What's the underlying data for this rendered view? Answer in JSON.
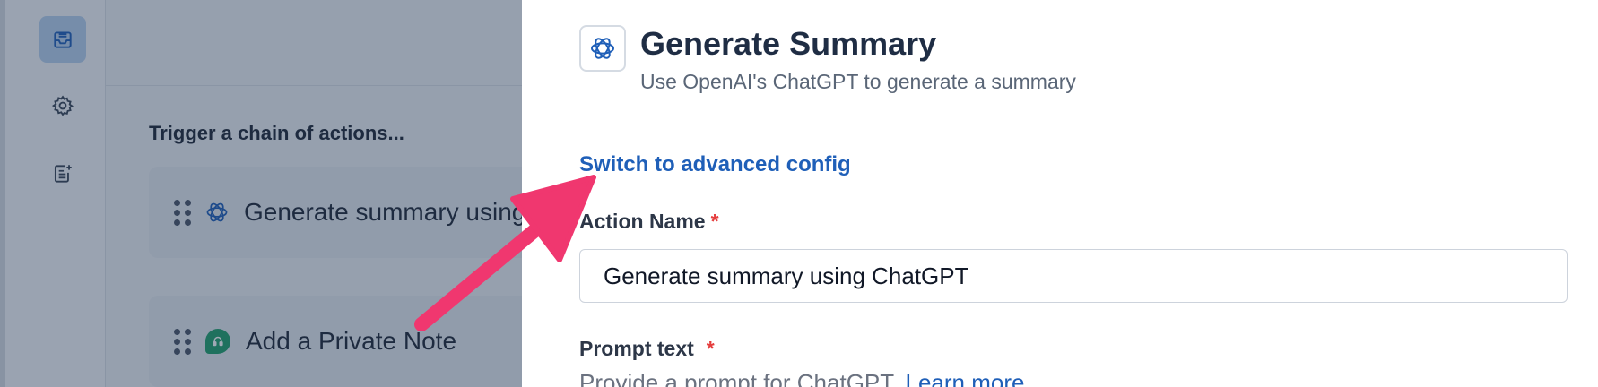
{
  "sidebar": {
    "items": [
      {
        "icon": "inbox-icon",
        "active": true
      },
      {
        "icon": "gear-icon",
        "active": false
      },
      {
        "icon": "notes-icon",
        "active": false
      }
    ]
  },
  "chain": {
    "title": "Trigger a chain of actions...",
    "actions": [
      {
        "label": "Generate summary using ChatGPT",
        "icon": "openai-icon"
      },
      {
        "label": "Add a Private Note",
        "icon": "private-note-icon"
      }
    ]
  },
  "panel": {
    "icon": "openai-icon",
    "title": "Generate Summary",
    "subtitle": "Use OpenAI's ChatGPT to generate a summary",
    "advanced_link": "Switch to advanced config",
    "action_name": {
      "label": "Action Name",
      "required_marker": "*",
      "value": "Generate summary using ChatGPT"
    },
    "prompt_text": {
      "label": "Prompt text",
      "required_marker": "*",
      "helper": "Provide a prompt for ChatGPT.",
      "learn_more": "Learn more"
    }
  },
  "annotation": {
    "type": "arrow",
    "color": "#f0376f"
  },
  "colors": {
    "accent": "#1f5fb8",
    "required": "#e53e3e",
    "annotation": "#f0376f"
  }
}
